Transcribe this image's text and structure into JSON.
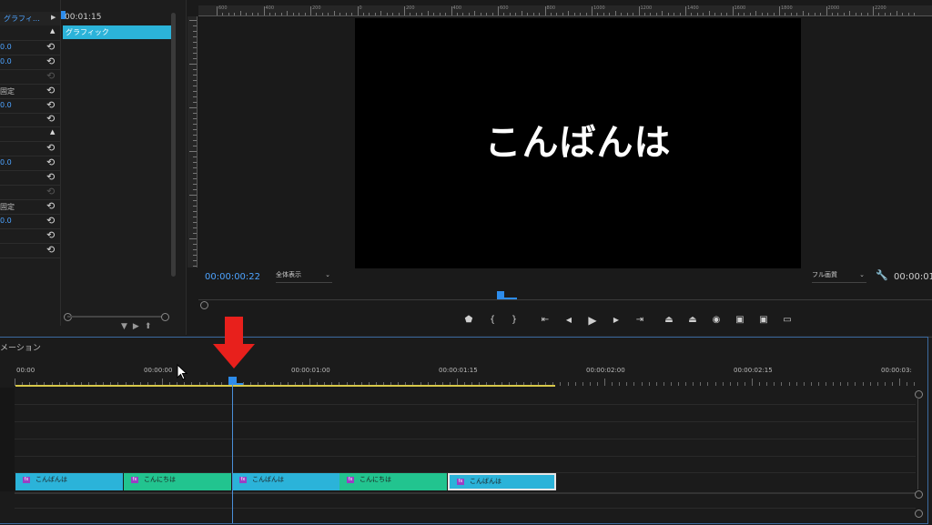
{
  "effect_controls": {
    "clip_name": "グラフィ…",
    "timecode": "00:01:15",
    "graphic_bar_label": "グラフィック",
    "rows": [
      {
        "kind": "expand",
        "text": ""
      },
      {
        "kind": "value",
        "text": "0.0"
      },
      {
        "kind": "value",
        "text": "0.0"
      },
      {
        "kind": "dim",
        "text": ""
      },
      {
        "kind": "label",
        "text": "固定"
      },
      {
        "kind": "value",
        "text": "0.0"
      },
      {
        "kind": "plain",
        "text": ""
      },
      {
        "kind": "expand",
        "text": ""
      },
      {
        "kind": "plain",
        "text": ""
      },
      {
        "kind": "value",
        "text": "0.0"
      },
      {
        "kind": "plain",
        "text": ""
      },
      {
        "kind": "dim",
        "text": ""
      },
      {
        "kind": "label",
        "text": "固定"
      },
      {
        "kind": "value",
        "text": "0.0"
      },
      {
        "kind": "plain",
        "text": ""
      },
      {
        "kind": "plain",
        "text": ""
      }
    ],
    "last_reset_row": true
  },
  "program_monitor": {
    "video_text": "こんばんは",
    "timecode": "00:00:00:22",
    "fit_label": "全体表示",
    "quality_label": "フル画質",
    "duration": "00:00:01",
    "ruler_labels": [
      "600",
      "400",
      "200",
      "0",
      "200",
      "400",
      "600",
      "800",
      "1000",
      "1200",
      "1400",
      "1600",
      "1800",
      "2000",
      "2200"
    ],
    "transport_icons": [
      "marker-icon",
      "in-point-icon",
      "out-point-icon",
      "go-to-in-icon",
      "step-back-icon",
      "play-icon",
      "step-forward-icon",
      "go-to-out-icon",
      "lift-icon",
      "extract-icon",
      "export-frame-icon",
      "insert-icon",
      "overwrite-icon",
      "comparison-view-icon"
    ]
  },
  "timeline": {
    "title": "メーション",
    "time_labels": [
      "00:00",
      "00:00:00",
      "00:00:01:00",
      "00:00:01:15",
      "00:00:02:00",
      "00:00:02:15",
      "00:00:03:"
    ],
    "clips": [
      {
        "name": "こんばんは",
        "color": "blue"
      },
      {
        "name": "こんにちは",
        "color": "green"
      },
      {
        "name": "こんばんは",
        "color": "blue"
      },
      {
        "name": "こんにちは",
        "color": "green"
      },
      {
        "name": "こんばんは",
        "color": "blue",
        "selected": true
      }
    ],
    "fx_badge": "fx"
  },
  "colors": {
    "accent_blue": "#2d8ceb",
    "clip_blue": "#2bb3d9",
    "clip_green": "#22c48f",
    "fx_purple": "#9b3fc4",
    "arrow_red": "#e8201c",
    "work_area_yellow": "#d7c84a"
  }
}
